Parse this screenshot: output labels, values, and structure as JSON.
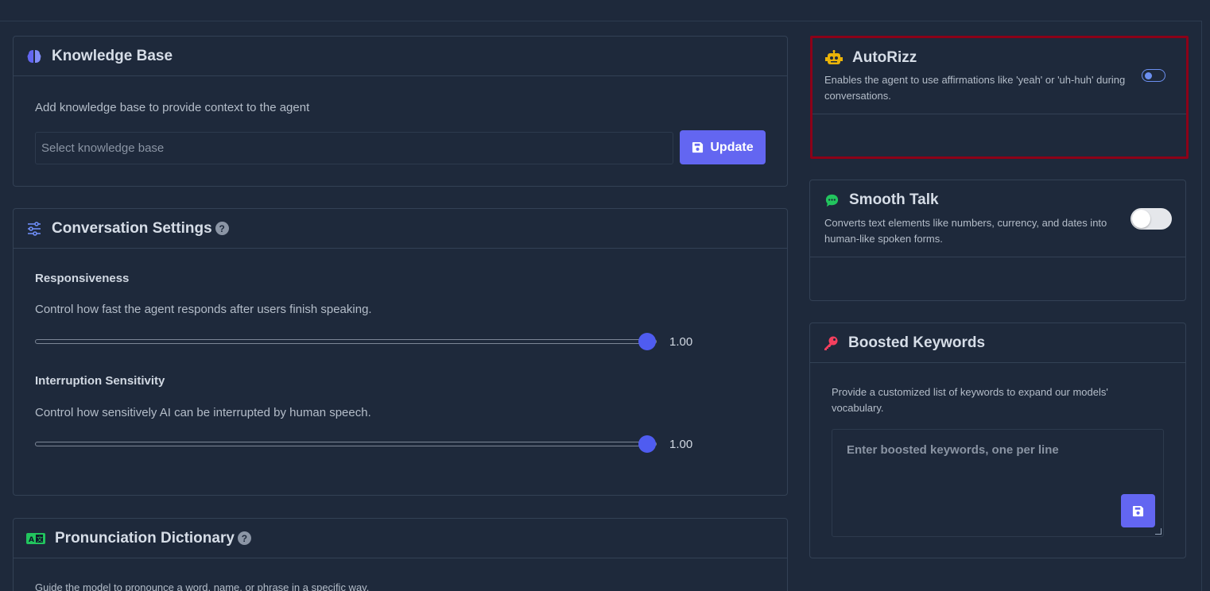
{
  "knowledge_base": {
    "title": "Knowledge Base",
    "description": "Add knowledge base to provide context to the agent",
    "select_placeholder": "Select knowledge base",
    "update_label": "Update"
  },
  "conversation_settings": {
    "title": "Conversation Settings",
    "help": "?",
    "responsiveness": {
      "label": "Responsiveness",
      "description": "Control how fast the agent responds after users finish speaking.",
      "value": "1.00",
      "fraction": 1.0
    },
    "interruption": {
      "label": "Interruption Sensitivity",
      "description": "Control how sensitively AI can be interrupted by human speech.",
      "value": "1.00",
      "fraction": 1.0
    }
  },
  "pronunciation": {
    "title": "Pronunciation Dictionary",
    "help": "?",
    "description": "Guide the model to pronounce a word, name, or phrase in a specific way."
  },
  "autorizz": {
    "title": "AutoRizz",
    "description": "Enables the agent to use affirmations like 'yeah' or 'uh-huh' during conversations.",
    "enabled": false
  },
  "smooth_talk": {
    "title": "Smooth Talk",
    "description": "Converts text elements like numbers, currency, and dates into human-like spoken forms.",
    "enabled": false
  },
  "boosted_keywords": {
    "title": "Boosted Keywords",
    "description": "Provide a customized list of keywords to expand our models' vocabulary.",
    "placeholder": "Enter boosted keywords, one per line"
  },
  "colors": {
    "background": "#1e293b",
    "accent": "#6366f1",
    "highlight_border": "#8c0018",
    "robot_icon": "#eab308",
    "chat_icon": "#22c55e",
    "key_icon": "#f43f5e"
  }
}
